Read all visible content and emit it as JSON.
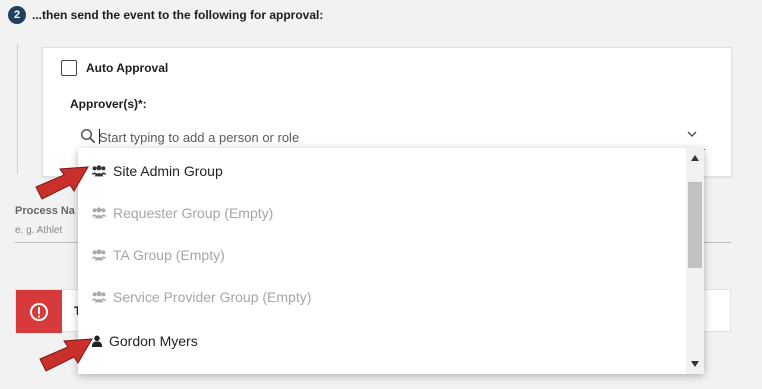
{
  "step": {
    "number": "2",
    "title": "...then send the event to the following for approval:"
  },
  "approval": {
    "auto_label": "Auto Approval",
    "approvers_label": "Approver(s)*:",
    "search_placeholder": "Start typing to add a person or role"
  },
  "dropdown": {
    "options": [
      {
        "label": "Site Admin Group",
        "icon": "group-icon",
        "enabled": true
      },
      {
        "label": "Requester Group (Empty)",
        "icon": "group-icon",
        "enabled": false
      },
      {
        "label": "TA Group (Empty)",
        "icon": "group-icon",
        "enabled": false
      },
      {
        "label": "Service Provider Group (Empty)",
        "icon": "group-icon",
        "enabled": false
      },
      {
        "label": "Gordon Myers",
        "icon": "person-icon",
        "enabled": true
      }
    ]
  },
  "process": {
    "label_visible": "Process Na",
    "placeholder_visible": "e. g. Athlet"
  },
  "alert": {
    "text_visible": "T"
  },
  "colors": {
    "step_badge": "#21405e",
    "input_underline": "#2a7cc7",
    "alert_red": "#d73a3a",
    "arrow_red": "#c9302c"
  }
}
